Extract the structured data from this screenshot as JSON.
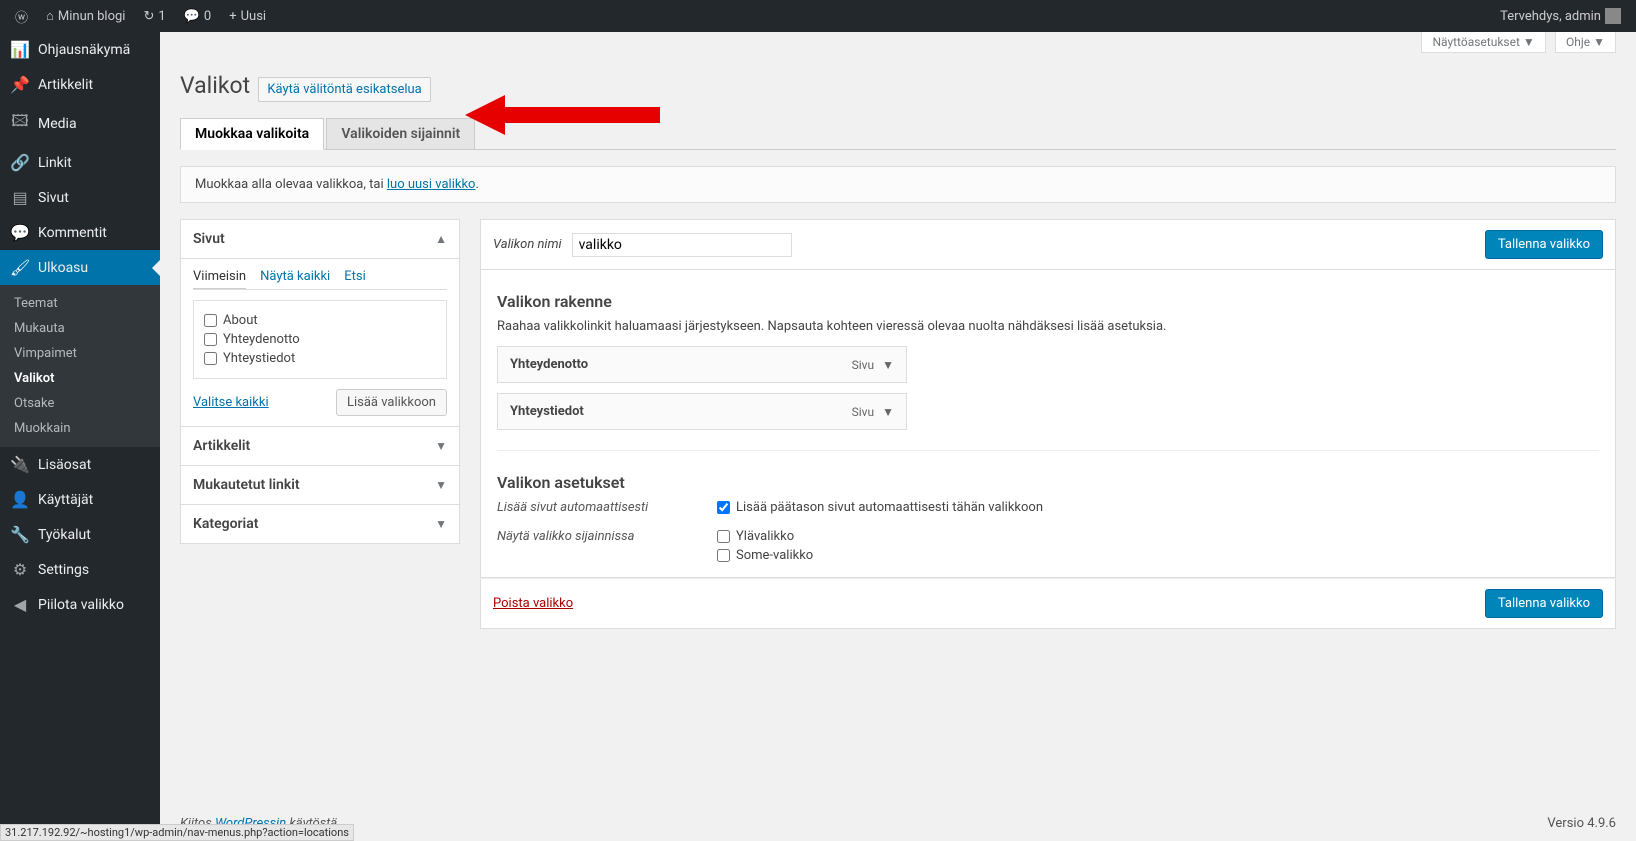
{
  "adminbar": {
    "site_name": "Minun blogi",
    "updates": "1",
    "comments": "0",
    "new": "Uusi",
    "greeting": "Tervehdys, admin"
  },
  "sidebar": {
    "items": [
      {
        "label": "Ohjausnäkymä",
        "icon": "⌂"
      },
      {
        "label": "Artikkelit",
        "icon": "✎"
      },
      {
        "label": "Media",
        "icon": "🖾"
      },
      {
        "label": "Linkit",
        "icon": "🔗"
      },
      {
        "label": "Sivut",
        "icon": "▤"
      },
      {
        "label": "Kommentit",
        "icon": "💬"
      },
      {
        "label": "Ulkoasu",
        "icon": "🖌"
      },
      {
        "label": "Lisäosat",
        "icon": "🔌"
      },
      {
        "label": "Käyttäjät",
        "icon": "👤"
      },
      {
        "label": "Työkalut",
        "icon": "🔧"
      },
      {
        "label": "Settings",
        "icon": "⚙"
      },
      {
        "label": "Piilota valikko",
        "icon": "◀"
      }
    ],
    "submenu": [
      "Teemat",
      "Mukauta",
      "Vimpaimet",
      "Valikot",
      "Otsake",
      "Muokkain"
    ]
  },
  "screen_meta": {
    "options": "Näyttöasetukset",
    "help": "Ohje"
  },
  "page": {
    "title": "Valikot",
    "preview_btn": "Käytä välitöntä esikatselua"
  },
  "tabs": {
    "edit": "Muokkaa valikoita",
    "locations": "Valikoiden sijainnit"
  },
  "manage": {
    "text": "Muokkaa alla olevaa valikkoa, tai ",
    "link": "luo uusi valikko",
    "suffix": "."
  },
  "accordions": {
    "pages": "Sivut",
    "posts": "Artikkelit",
    "custom": "Mukautetut linkit",
    "cats": "Kategoriat"
  },
  "subtabs": {
    "recent": "Viimeisin",
    "all": "Näytä kaikki",
    "search": "Etsi"
  },
  "page_items": [
    "About",
    "Yhteydenotto",
    "Yhteystiedot"
  ],
  "select_all": "Valitse kaikki",
  "add_to_menu": "Lisää valikkoon",
  "menu_name_label": "Valikon nimi",
  "menu_name_value": "valikko",
  "save_button": "Tallenna valikko",
  "structure": {
    "title": "Valikon rakenne",
    "desc": "Raahaa valikkolinkit haluamaasi järjestykseen. Napsauta kohteen vieressä olevaa nuolta nähdäksesi lisää asetuksia."
  },
  "menu_items": [
    {
      "title": "Yhteydenotto",
      "type": "Sivu"
    },
    {
      "title": "Yhteystiedot",
      "type": "Sivu"
    }
  ],
  "settings": {
    "title": "Valikon asetukset",
    "auto_label": "Lisää sivut automaattisesti",
    "auto_cb": "Lisää päätason sivut automaattisesti tähän valikkoon",
    "loc_label": "Näytä valikko sijainnissa",
    "loc_top": "Ylävalikko",
    "loc_some": "Some-valikko"
  },
  "delete": "Poista valikko",
  "footer": {
    "thanks": "Kiitos ",
    "wp": "WordPressin",
    "suffix": " käytöstä",
    "version": "Versio 4.9.6"
  },
  "statusbar": "31.217.192.92/~hosting1/wp-admin/nav-menus.php?action=locations"
}
